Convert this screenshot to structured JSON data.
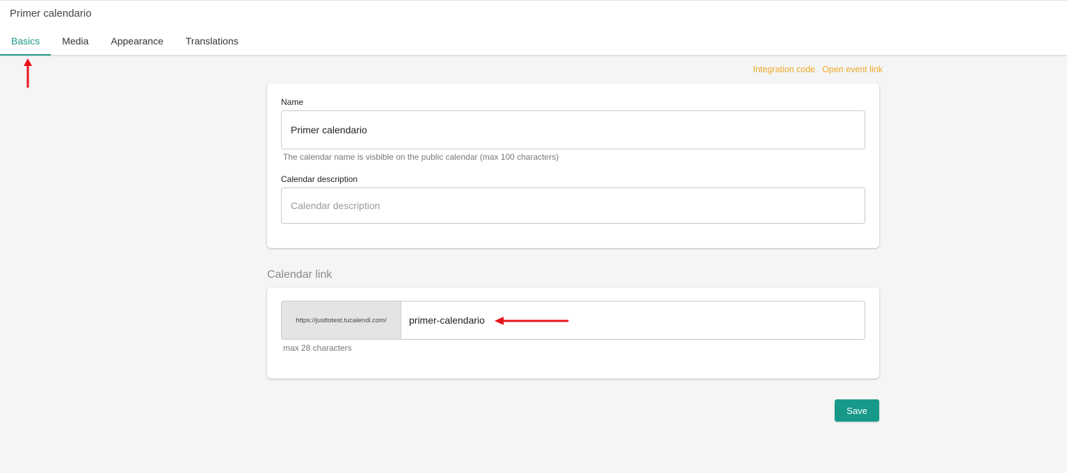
{
  "page": {
    "title": "Primer calendario"
  },
  "tabs": [
    {
      "label": "Basics",
      "active": true
    },
    {
      "label": "Media",
      "active": false
    },
    {
      "label": "Appearance",
      "active": false
    },
    {
      "label": "Translations",
      "active": false
    }
  ],
  "top_links": {
    "integration_code": "Integration code",
    "open_event_link": "Open event link"
  },
  "basics": {
    "name_label": "Name",
    "name_value": "Primer calendario",
    "name_hint": "The calendar name is visbible on the public calendar (max 100 characters)",
    "description_label": "Calendar description",
    "description_value": "",
    "description_placeholder": "Calendar description"
  },
  "calendar_link": {
    "section_title": "Calendar link",
    "prefix": "https://justtotest.tucalendi.com/",
    "slug": "primer-calendario",
    "hint": "max 28 characters"
  },
  "actions": {
    "save_label": "Save"
  },
  "colors": {
    "accent": "#1a9a8a",
    "link": "#f0a825",
    "annotation": "#e8141b"
  },
  "annotations": [
    {
      "icon": "red-arrow-up-icon",
      "target": "tab-basics"
    },
    {
      "icon": "red-arrow-left-icon",
      "target": "calendar-slug-input"
    }
  ]
}
